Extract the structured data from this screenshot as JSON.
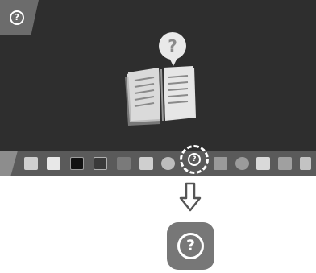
{
  "colors": {
    "screen_bg": "#2e2e2e",
    "taskbar_bg": "#5a5a5a",
    "help_tile_bg": "#777777",
    "highlight": "#ffffff"
  },
  "corner": {
    "icon": "help-icon",
    "glyph": "?"
  },
  "hero": {
    "icon": "open-book-question-illustration",
    "bubble_glyph": "?"
  },
  "taskbar": {
    "apps": [
      {
        "icon": "gallery-app-icon"
      },
      {
        "icon": "connect-app-icon"
      },
      {
        "icon": "tv-input-app-icon"
      },
      {
        "icon": "camera-app-icon"
      },
      {
        "icon": "media-app-icon"
      },
      {
        "icon": "remote-app-icon"
      },
      {
        "icon": "cube-app-icon"
      },
      {
        "icon": "help-app-icon",
        "highlighted": true,
        "glyph": "?"
      },
      {
        "icon": "share-app-icon"
      },
      {
        "icon": "refresh-app-icon"
      },
      {
        "icon": "screen-capture-app-icon"
      },
      {
        "icon": "trash-app-icon"
      },
      {
        "icon": "lock-app-icon"
      }
    ]
  },
  "callout": {
    "icon": "down-arrow-icon"
  },
  "enlarged_icon": {
    "icon": "help-app-icon",
    "glyph": "?"
  }
}
